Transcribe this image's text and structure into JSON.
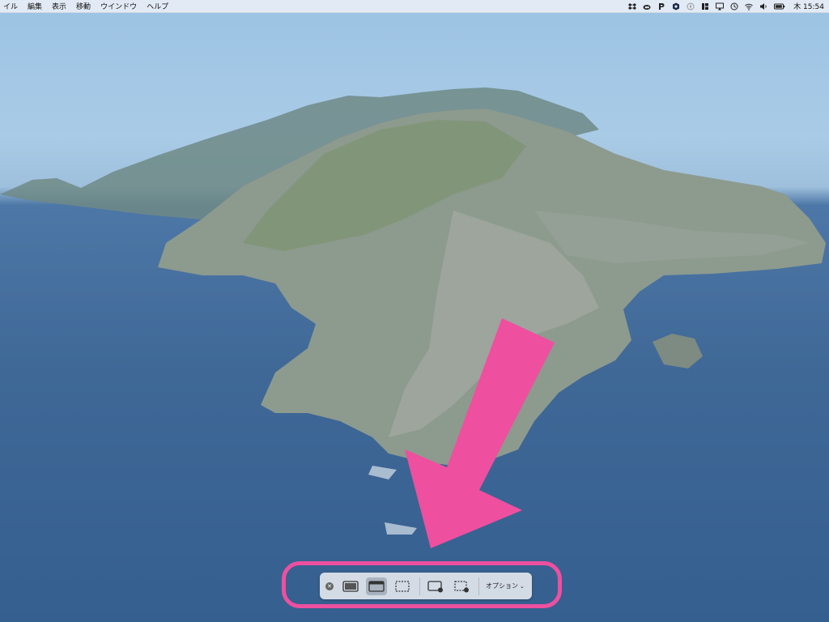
{
  "menubar": {
    "items": [
      "イル",
      "編集",
      "表示",
      "移動",
      "ウインドウ",
      "ヘルプ"
    ],
    "clock": "木 15:54",
    "status_icons": [
      "dropbox-icon",
      "creative-cloud-icon",
      "p-app-icon",
      "shield-app-icon",
      "rocket-icon",
      "bartender-icon",
      "airplay-icon",
      "time-machine-icon",
      "wifi-icon",
      "volume-icon",
      "battery-icon"
    ]
  },
  "toolbar": {
    "options_label": "オプション",
    "buttons": [
      "capture-entire-screen",
      "capture-selected-window",
      "capture-selected-portion",
      "record-entire-screen",
      "record-selected-portion"
    ],
    "active_button": "capture-selected-window"
  },
  "annotation": {
    "color": "#ee4f9f"
  }
}
